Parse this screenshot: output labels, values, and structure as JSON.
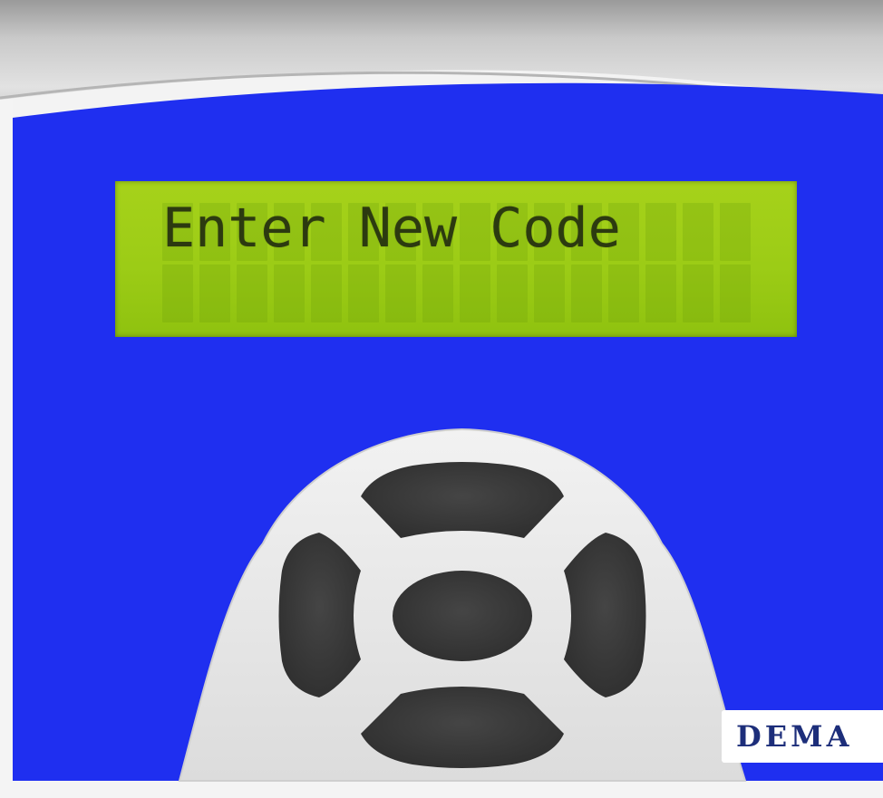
{
  "display": {
    "line1": "Enter New Code",
    "line2": ""
  },
  "brand": {
    "name": "DEMA"
  },
  "keypad": {
    "up_icon": "arrow-up-key-icon",
    "down_icon": "arrow-down-key-icon",
    "left_icon": "arrow-left-key-icon",
    "right_icon": "arrow-right-key-icon",
    "center_icon": "enter-key-icon"
  },
  "colors": {
    "panel_blue": "#1f2ff0",
    "lcd_green": "#9ccc16",
    "lcd_text": "#2c3a10",
    "key_dark": "#3a3a3a",
    "pad_gray": "#e8e8e8",
    "brand_navy": "#1d2e7a"
  }
}
